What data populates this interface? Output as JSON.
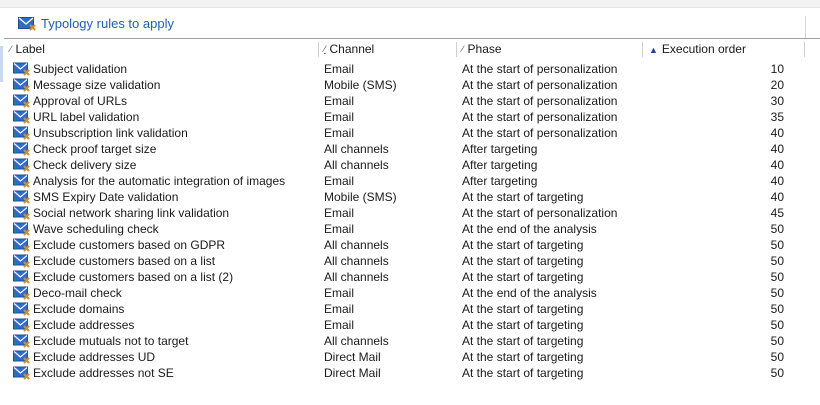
{
  "title": {
    "text": "Typology rules to apply",
    "icon": "mail-rule-icon"
  },
  "columns": {
    "label": "Label",
    "channel": "Channel",
    "phase": "Phase",
    "order": "Execution order"
  },
  "rows": [
    {
      "label": "Subject validation",
      "channel": "Email",
      "phase": "At the start of personalization",
      "order": "10"
    },
    {
      "label": "Message size validation",
      "channel": "Mobile (SMS)",
      "phase": "At the start of personalization",
      "order": "20"
    },
    {
      "label": "Approval of URLs",
      "channel": "Email",
      "phase": "At the start of personalization",
      "order": "30"
    },
    {
      "label": "URL label validation",
      "channel": "Email",
      "phase": "At the start of personalization",
      "order": "35"
    },
    {
      "label": "Unsubscription link validation",
      "channel": "Email",
      "phase": "At the start of personalization",
      "order": "40"
    },
    {
      "label": "Check proof target size",
      "channel": "All channels",
      "phase": "After targeting",
      "order": "40"
    },
    {
      "label": "Check delivery size",
      "channel": "All channels",
      "phase": "After targeting",
      "order": "40"
    },
    {
      "label": "Analysis for the automatic integration of images",
      "channel": "Email",
      "phase": "After targeting",
      "order": "40"
    },
    {
      "label": "SMS Expiry Date validation",
      "channel": "Mobile (SMS)",
      "phase": "At the start of targeting",
      "order": "40"
    },
    {
      "label": "Social network sharing link validation",
      "channel": "Email",
      "phase": "At the start of personalization",
      "order": "45"
    },
    {
      "label": "Wave scheduling check",
      "channel": "Email",
      "phase": "At the end of the analysis",
      "order": "50"
    },
    {
      "label": "Exclude customers based on GDPR",
      "channel": "All channels",
      "phase": "At the start of targeting",
      "order": "50"
    },
    {
      "label": "Exclude customers based on a list",
      "channel": "All channels",
      "phase": "At the start of targeting",
      "order": "50"
    },
    {
      "label": "Exclude customers based on a list (2)",
      "channel": "All channels",
      "phase": "At the start of targeting",
      "order": "50"
    },
    {
      "label": "Deco-mail check",
      "channel": "Email",
      "phase": "At the end of the analysis",
      "order": "50"
    },
    {
      "label": "Exclude domains",
      "channel": "Email",
      "phase": "At the start of targeting",
      "order": "50"
    },
    {
      "label": "Exclude addresses",
      "channel": "Email",
      "phase": "At the start of targeting",
      "order": "50"
    },
    {
      "label": "Exclude mutuals not to target",
      "channel": "All channels",
      "phase": "At the start of targeting",
      "order": "50"
    },
    {
      "label": "Exclude addresses UD",
      "channel": "Direct Mail",
      "phase": "At the start of targeting",
      "order": "50"
    },
    {
      "label": "Exclude addresses not SE",
      "channel": "Direct Mail",
      "phase": "At the start of targeting",
      "order": "50"
    }
  ],
  "colors": {
    "link": "#1f5fbf",
    "icon_blue": "#2f6cc9",
    "icon_orange": "#e08a1e"
  }
}
